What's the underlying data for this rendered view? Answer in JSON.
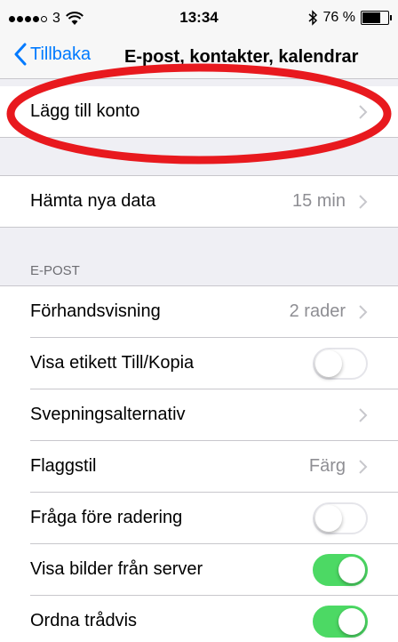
{
  "status": {
    "carrier": "3",
    "time": "13:34",
    "battery": "76 %",
    "battery_level": 0.76
  },
  "nav": {
    "back_label": "Tillbaka",
    "title": "E-post, kontakter, kalendrar"
  },
  "account": {
    "add_account": "Lägg till konto"
  },
  "fetch": {
    "label": "Hämta nya data",
    "value": "15 min"
  },
  "mail_section": {
    "header": "E-POST",
    "rows": [
      {
        "label": "Förhandsvisning",
        "value": "2 rader",
        "type": "detail"
      },
      {
        "label": "Visa etikett Till/Kopia",
        "type": "switch",
        "on": false
      },
      {
        "label": "Svepningsalternativ",
        "value": "",
        "type": "detail"
      },
      {
        "label": "Flaggstil",
        "value": "Färg",
        "type": "detail"
      },
      {
        "label": "Fråga före radering",
        "type": "switch",
        "on": false
      },
      {
        "label": "Visa bilder från server",
        "type": "switch",
        "on": true
      },
      {
        "label": "Ordna trådvis",
        "type": "switch",
        "on": true
      }
    ]
  },
  "colors": {
    "accent": "#007aff",
    "switch_on": "#4cd964",
    "annotation": "#e8191e"
  }
}
